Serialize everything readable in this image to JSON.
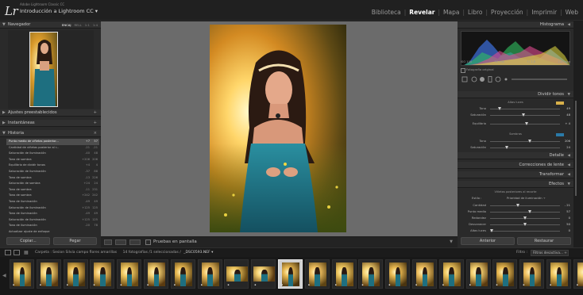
{
  "app": {
    "logo": "Lr",
    "subtitle": "Adobe Lightroom Classic CC",
    "catalog": "Introducción a Lightroom CC ▾"
  },
  "modules": [
    {
      "label": "Biblioteca",
      "active": false
    },
    {
      "label": "Revelar",
      "active": true
    },
    {
      "label": "Mapa",
      "active": false
    },
    {
      "label": "Libro",
      "active": false
    },
    {
      "label": "Proyección",
      "active": false
    },
    {
      "label": "Imprimir",
      "active": false
    },
    {
      "label": "Web",
      "active": false
    }
  ],
  "left": {
    "navigator": {
      "title": "Navegador",
      "modes": [
        "ENCAJ",
        "RELL",
        "1:1",
        "1:4"
      ],
      "active_mode": "ENCAJ"
    },
    "presets_title": "Ajustes preestablecidos",
    "snapshots_title": "Instantáneas",
    "history": {
      "title": "Historia",
      "rows": [
        {
          "name": "Punto medio de viñetas posterior...",
          "a": "+7",
          "b": "57",
          "selected": true
        },
        {
          "name": "Cantidad de viñetas posterior al r...",
          "a": "-21",
          "b": "-21",
          "selected": false
        },
        {
          "name": "Saturación de iluminación",
          "a": "-40",
          "b": "48",
          "selected": false
        },
        {
          "name": "Tono de sombra",
          "a": "+206",
          "b": "206",
          "selected": false
        },
        {
          "name": "Equilibrio de dividir tonos",
          "a": "+4",
          "b": "4",
          "selected": false
        },
        {
          "name": "Saturación de iluminación",
          "a": "-37",
          "b": "88",
          "selected": false
        },
        {
          "name": "Tono de sombra",
          "a": "-13",
          "b": "226",
          "selected": false
        },
        {
          "name": "Saturación de sombra",
          "a": "+24",
          "b": "24",
          "selected": false
        },
        {
          "name": "Tono de sombra",
          "a": "-11",
          "b": "231",
          "selected": false
        },
        {
          "name": "Tono de sombra",
          "a": "+242",
          "b": "242",
          "selected": false
        },
        {
          "name": "Tono de iluminación",
          "a": "-49",
          "b": "49",
          "selected": false
        },
        {
          "name": "Saturación de iluminación",
          "a": "+125",
          "b": "125",
          "selected": false
        },
        {
          "name": "Tono de iluminación",
          "a": "-49",
          "b": "49",
          "selected": false
        },
        {
          "name": "Saturación de iluminación",
          "a": "+125",
          "b": "125",
          "selected": false
        },
        {
          "name": "Tono de iluminación",
          "a": "-20",
          "b": "78",
          "selected": false
        },
        {
          "name": "Actualizar ajuste de enfoque",
          "a": "",
          "b": "",
          "selected": false
        }
      ]
    },
    "copy_button": "Copiar...",
    "paste_button": "Pegar"
  },
  "toolbar": {
    "proof_label": "Pruebas en pantalla"
  },
  "right": {
    "histogram_title": "Histograma",
    "hist_info": [
      "ISO 100",
      "50 mm",
      "f / 1,8",
      "1/80 seg"
    ],
    "original_label": "Fotografía original",
    "split_toning": {
      "title": "Dividir tonos",
      "highlights_label": "Altas luces",
      "highlight_color": "#d8b04a",
      "shadows_label": "Sombras",
      "shadow_color": "#2a7aa8",
      "sliders": [
        {
          "label": "Tono",
          "value": "49",
          "pos": 0.14
        },
        {
          "label": "Saturación",
          "value": "48",
          "pos": 0.48
        },
        {
          "label": "Equilibrio",
          "value": "+ 4",
          "pos": 0.52
        },
        {
          "label": "Tono",
          "value": "206",
          "pos": 0.57
        },
        {
          "label": "Saturación",
          "value": "24",
          "pos": 0.24
        }
      ]
    },
    "detail_title": "Detalle",
    "lens_title": "Correcciones de lente",
    "transform_title": "Transformar",
    "effects": {
      "title": "Efectos",
      "vignette_title": "Viñetas posteriores al recorte",
      "style_label": "Estilo :",
      "style_value": "Prioridad de iluminación ÷",
      "sliders": [
        {
          "label": "Cantidad",
          "value": "- 21",
          "pos": 0.4
        },
        {
          "label": "Punto medio",
          "value": "57",
          "pos": 0.57
        },
        {
          "label": "Redondez",
          "value": "0",
          "pos": 0.5
        },
        {
          "label": "Desvanecer",
          "value": "50",
          "pos": 0.5
        },
        {
          "label": "Altas luces",
          "value": "0",
          "pos": 0.02
        }
      ]
    },
    "previous_button": "Anterior",
    "reset_button": "Restaurar"
  },
  "filmstrip": {
    "folder": "Carpeta : Sesion Silvia campo flores amarillas",
    "count": "14 fotografías /1 seleccionadas /",
    "filename": "_DSC0593.NEF ▾",
    "filter_label": "Filtro :",
    "filter_value": "Filtros desactiva... ÷",
    "selected_index": 10,
    "thumbs": [
      "portrait",
      "portrait",
      "portrait",
      "portrait",
      "portrait",
      "portrait",
      "portrait",
      "portrait",
      "wide",
      "wide",
      "portrait",
      "portrait",
      "portrait",
      "portrait",
      "portrait",
      "portrait",
      "portrait",
      "portrait",
      "portrait",
      "portrait",
      "portrait",
      "portrait"
    ]
  }
}
